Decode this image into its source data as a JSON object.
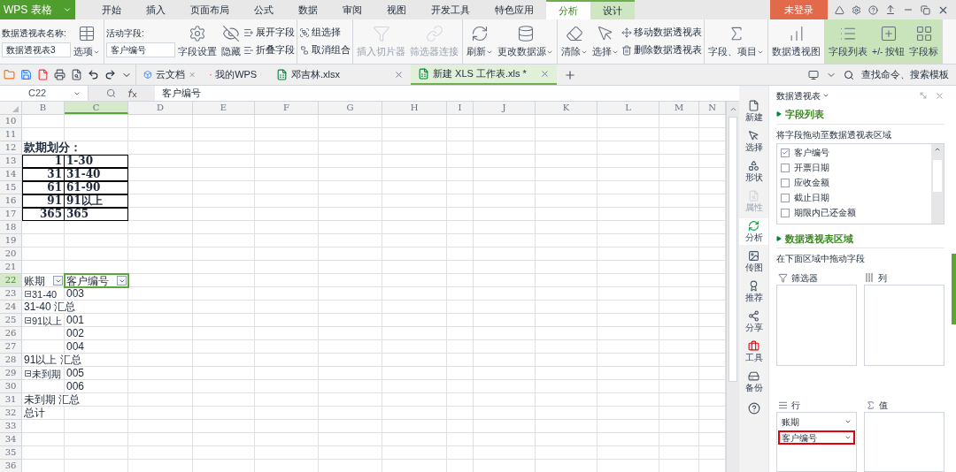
{
  "app": {
    "name": "WPS 表格"
  },
  "menu_tabs": [
    {
      "label": "开始",
      "selected": false,
      "contextual": false
    },
    {
      "label": "插入",
      "selected": false,
      "contextual": false
    },
    {
      "label": "页面布局",
      "selected": false,
      "contextual": false
    },
    {
      "label": "公式",
      "selected": false,
      "contextual": false
    },
    {
      "label": "数据",
      "selected": false,
      "contextual": false
    },
    {
      "label": "审阅",
      "selected": false,
      "contextual": false
    },
    {
      "label": "视图",
      "selected": false,
      "contextual": false
    },
    {
      "label": "开发工具",
      "selected": false,
      "contextual": false
    },
    {
      "label": "特色应用",
      "selected": false,
      "contextual": false
    },
    {
      "label": "分析",
      "selected": true,
      "contextual": true
    },
    {
      "label": "设计",
      "selected": false,
      "contextual": true
    }
  ],
  "login": "未登录",
  "ribbon": [
    {
      "highlighted": false,
      "items": [
        {
          "kind": "field",
          "label": "数据透视表名称:",
          "value": "数据透视表3"
        },
        {
          "kind": "big",
          "label": "选项",
          "dropdown": true,
          "disabled": false
        }
      ]
    },
    {
      "highlighted": false,
      "items": [
        {
          "kind": "field",
          "label": "活动字段:",
          "value": "客户编号"
        },
        {
          "kind": "big",
          "label": "字段设置",
          "dropdown": false,
          "disabled": false
        },
        {
          "kind": "big",
          "label": "隐藏",
          "dropdown": false,
          "disabled": false
        },
        {
          "kind": "smalls",
          "labels": [
            "展开字段",
            "折叠字段"
          ]
        }
      ]
    },
    {
      "highlighted": false,
      "items": [
        {
          "kind": "smalls",
          "labels": [
            "组选择",
            "取消组合"
          ]
        }
      ]
    },
    {
      "highlighted": false,
      "items": [
        {
          "kind": "big",
          "label": "插入切片器",
          "dropdown": false,
          "disabled": true
        },
        {
          "kind": "big",
          "label": "筛选器连接",
          "dropdown": false,
          "disabled": true
        }
      ]
    },
    {
      "highlighted": false,
      "items": [
        {
          "kind": "big",
          "label": "刷新",
          "dropdown": true,
          "disabled": false
        },
        {
          "kind": "big",
          "label": "更改数据源",
          "dropdown": true,
          "disabled": false
        }
      ]
    },
    {
      "highlighted": false,
      "items": [
        {
          "kind": "big",
          "label": "清除",
          "dropdown": true,
          "disabled": false
        },
        {
          "kind": "big",
          "label": "选择",
          "dropdown": true,
          "disabled": false
        },
        {
          "kind": "smalls",
          "labels": [
            "移动数据透视表",
            "删除数据透视表"
          ]
        }
      ]
    },
    {
      "highlighted": false,
      "items": [
        {
          "kind": "big",
          "label": "字段、项目",
          "dropdown": true,
          "disabled": false
        }
      ]
    },
    {
      "highlighted": false,
      "items": [
        {
          "kind": "big",
          "label": "数据透视图",
          "dropdown": false,
          "disabled": false
        }
      ]
    },
    {
      "highlighted": true,
      "items": [
        {
          "kind": "big",
          "label": "字段列表",
          "dropdown": false,
          "disabled": false
        },
        {
          "kind": "big",
          "label": "+/- 按钮",
          "dropdown": false,
          "disabled": false
        },
        {
          "kind": "big",
          "label": "字段标",
          "dropdown": false,
          "disabled": false
        }
      ]
    }
  ],
  "doc_tabs": [
    {
      "kind": "cloud",
      "label": "云文档",
      "selected": false
    },
    {
      "kind": "wps",
      "label": "我的WPS",
      "selected": false
    },
    {
      "kind": "sheet",
      "label": "邓吉林.xlsx",
      "selected": false
    },
    {
      "kind": "sheet",
      "label": "新建 XLS 工作表.xls *",
      "selected": true
    }
  ],
  "search": "查找命令、搜索模板",
  "formula_bar": {
    "cell": "C22",
    "value": "客户编号"
  },
  "columns": [
    {
      "label": "B",
      "selected": false
    },
    {
      "label": "C",
      "selected": true
    },
    {
      "label": "D",
      "selected": false
    },
    {
      "label": "E",
      "selected": false
    },
    {
      "label": "F",
      "selected": false
    },
    {
      "label": "G",
      "selected": false
    },
    {
      "label": "H",
      "selected": false
    },
    {
      "label": "I",
      "selected": false
    },
    {
      "label": "J",
      "selected": false
    },
    {
      "label": "K",
      "selected": false
    },
    {
      "label": "L",
      "selected": false
    },
    {
      "label": "M",
      "selected": false
    },
    {
      "label": "N",
      "selected": false
    }
  ],
  "rows": [
    {
      "num": "10",
      "kind": "blank",
      "selected": false
    },
    {
      "num": "11",
      "kind": "blank",
      "selected": false
    },
    {
      "num": "12",
      "kind": "heading",
      "selected": false,
      "b": "款期划分："
    },
    {
      "num": "13",
      "kind": "range",
      "selected": false,
      "b": "1",
      "c": "1-30"
    },
    {
      "num": "14",
      "kind": "range",
      "selected": false,
      "b": "31",
      "c": "31-40"
    },
    {
      "num": "15",
      "kind": "range",
      "selected": false,
      "b": "61",
      "c": "61-90"
    },
    {
      "num": "16",
      "kind": "range",
      "selected": false,
      "b": "91",
      "c": "91以上"
    },
    {
      "num": "17",
      "kind": "range",
      "selected": false,
      "b": "365",
      "c": "365"
    },
    {
      "num": "18",
      "kind": "blank",
      "selected": false
    },
    {
      "num": "19",
      "kind": "blank",
      "selected": false
    },
    {
      "num": "20",
      "kind": "blank",
      "selected": false
    },
    {
      "num": "21",
      "kind": "blank",
      "selected": false
    },
    {
      "num": "22",
      "kind": "pivot_header",
      "selected": true,
      "b": "账期",
      "c": "客户编号"
    },
    {
      "num": "23",
      "kind": "item",
      "selected": false,
      "b": "31-40",
      "expanded": true,
      "c": "003"
    },
    {
      "num": "24",
      "kind": "subtotal",
      "selected": false,
      "b": "31-40 汇总"
    },
    {
      "num": "25",
      "kind": "item",
      "selected": false,
      "b": "91以上",
      "expanded": true,
      "c": "001"
    },
    {
      "num": "26",
      "kind": "item",
      "selected": false,
      "c": "002"
    },
    {
      "num": "27",
      "kind": "item",
      "selected": false,
      "c": "004"
    },
    {
      "num": "28",
      "kind": "subtotal",
      "selected": false,
      "b": "91以上  汇总"
    },
    {
      "num": "29",
      "kind": "item",
      "selected": false,
      "b": "未到期",
      "expanded": true,
      "c": "005"
    },
    {
      "num": "30",
      "kind": "item",
      "selected": false,
      "c": "006"
    },
    {
      "num": "31",
      "kind": "subtotal",
      "selected": false,
      "b": "未到期  汇总"
    },
    {
      "num": "32",
      "kind": "subtotal",
      "selected": false,
      "b": "总计"
    },
    {
      "num": "33",
      "kind": "blank",
      "selected": false
    },
    {
      "num": "34",
      "kind": "blank",
      "selected": false
    },
    {
      "num": "35",
      "kind": "blank",
      "selected": false
    },
    {
      "num": "36",
      "kind": "blank",
      "selected": false
    }
  ],
  "side_tools": [
    {
      "label": "新建",
      "selected": false,
      "disabled": false
    },
    {
      "label": "选择",
      "selected": false,
      "disabled": false
    },
    {
      "label": "形状",
      "selected": false,
      "disabled": false
    },
    {
      "label": "属性",
      "selected": false,
      "disabled": true
    },
    {
      "label": "分析",
      "selected": true,
      "disabled": false
    },
    {
      "label": "传图",
      "selected": false,
      "disabled": false
    },
    {
      "label": "推荐",
      "selected": false,
      "disabled": false
    },
    {
      "label": "分享",
      "selected": false,
      "disabled": false
    },
    {
      "label": "工具",
      "selected": false,
      "disabled": false
    },
    {
      "label": "备份",
      "selected": false,
      "disabled": false
    }
  ],
  "pivot_panel": {
    "title": "数据透视表",
    "field_section": {
      "title": "字段列表",
      "hint": "将字段拖动至数据透视表区域",
      "fields": [
        {
          "label": "客户编号",
          "checked": true
        },
        {
          "label": "开票日期",
          "checked": false
        },
        {
          "label": "应收金额",
          "checked": false
        },
        {
          "label": "截止日期",
          "checked": false
        },
        {
          "label": "期限内已还金额",
          "checked": false
        }
      ]
    },
    "area_section": {
      "title": "数据透视表区域",
      "hint": "在下面区域中拖动字段",
      "areas": [
        {
          "kind": "filter",
          "label": "筛选器"
        },
        {
          "kind": "columns",
          "label": "列"
        },
        {
          "kind": "rows",
          "label": "行",
          "items": [
            {
              "label": "账期",
              "highlighted": false
            },
            {
              "label": "客户编号",
              "highlighted": true
            }
          ]
        },
        {
          "kind": "values",
          "label": "值"
        }
      ]
    }
  }
}
